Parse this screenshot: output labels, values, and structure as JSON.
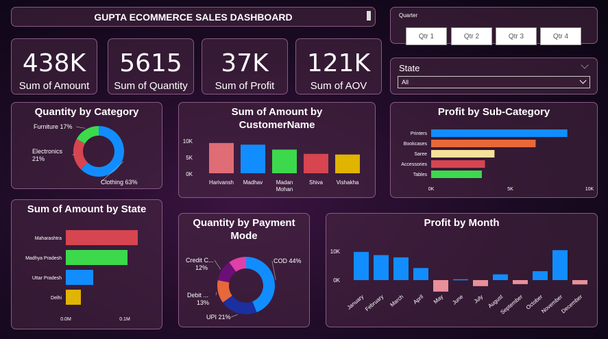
{
  "header": {
    "title": "GUPTA ECOMMERCE SALES DASHBOARD"
  },
  "quarter_slicer": {
    "label": "Quarter",
    "options": [
      "Qtr 1",
      "Qtr 2",
      "Qtr 3",
      "Qtr 4"
    ]
  },
  "state_slicer": {
    "label": "State",
    "selected": "All"
  },
  "kpis": [
    {
      "value": "438K",
      "label": "Sum of Amount"
    },
    {
      "value": "5615",
      "label": "Sum of Quantity"
    },
    {
      "value": "37K",
      "label": "Sum of Profit"
    },
    {
      "value": "121K",
      "label": "Sum of AOV"
    }
  ],
  "chart_data": [
    {
      "id": "qty_category",
      "type": "pie",
      "title": "Quantity by Category",
      "categories": [
        "Clothing",
        "Electronics",
        "Furniture"
      ],
      "values": [
        63,
        21,
        17
      ],
      "labels": [
        "Clothing 63%",
        "Electronics 21%",
        "Furniture 17%"
      ],
      "colors": [
        "#118dff",
        "#d64550",
        "#3cd94d"
      ]
    },
    {
      "id": "amount_customer",
      "type": "bar",
      "title": "Sum of Amount by CustomerName",
      "categories": [
        "Harivansh",
        "Madhav",
        "Madan Mohan",
        "Shiva",
        "Vishakha"
      ],
      "values": [
        9200,
        8700,
        7200,
        5900,
        5700
      ],
      "ylim": [
        0,
        10000
      ],
      "yticks": [
        "10K",
        "5K",
        "0K"
      ],
      "colors": [
        "#e06c75",
        "#118dff",
        "#3cd94d",
        "#d64550",
        "#e0b400"
      ]
    },
    {
      "id": "profit_subcat",
      "type": "bar",
      "orientation": "horizontal",
      "title": "Profit by Sub-Category",
      "categories": [
        "Printers",
        "Bookcases",
        "Saree",
        "Accessories",
        "Tables"
      ],
      "values": [
        8600,
        6600,
        4000,
        3400,
        3200
      ],
      "xlim": [
        0,
        10000
      ],
      "xticks": [
        "0K",
        "5K",
        "10K"
      ],
      "colors": [
        "#118dff",
        "#e8683a",
        "#f6e09a",
        "#d64550",
        "#3cd94d"
      ]
    },
    {
      "id": "amount_state",
      "type": "bar",
      "orientation": "horizontal",
      "title": "Sum of Amount by State",
      "categories": [
        "Maharashtra",
        "Madhya Pradesh",
        "Uttar Pradesh",
        "Delhi"
      ],
      "values": [
        105000,
        90000,
        40000,
        22000
      ],
      "xlim": [
        0,
        110000
      ],
      "xticks": [
        "0.0M",
        "0.1M"
      ],
      "colors": [
        "#d64550",
        "#3cd94d",
        "#118dff",
        "#e0b400"
      ]
    },
    {
      "id": "qty_payment",
      "type": "pie",
      "title": "Quantity by Payment Mode",
      "categories": [
        "COD",
        "UPI",
        "Debit Card",
        "Credit Card",
        "EMI"
      ],
      "values": [
        44,
        21,
        13,
        12,
        10
      ],
      "labels": [
        "COD 44%",
        "UPI 21%",
        "Debit ...\n13%",
        "Credit C...\n12%",
        ""
      ],
      "colors": [
        "#118dff",
        "#1b2f9e",
        "#e8683a",
        "#6b0f78",
        "#e040a8"
      ]
    },
    {
      "id": "profit_month",
      "type": "bar",
      "title": "Profit by Month",
      "categories": [
        "January",
        "February",
        "March",
        "April",
        "May",
        "June",
        "July",
        "August",
        "September",
        "October",
        "November",
        "December"
      ],
      "values": [
        9800,
        8700,
        7900,
        4200,
        -4000,
        300,
        -2100,
        2000,
        -1400,
        3100,
        10400,
        -1500
      ],
      "ylim": [
        -5000,
        11000
      ],
      "yticks": [
        "10K",
        "0K"
      ],
      "pos_color": "#118dff",
      "neg_color": "#e8909a"
    }
  ]
}
